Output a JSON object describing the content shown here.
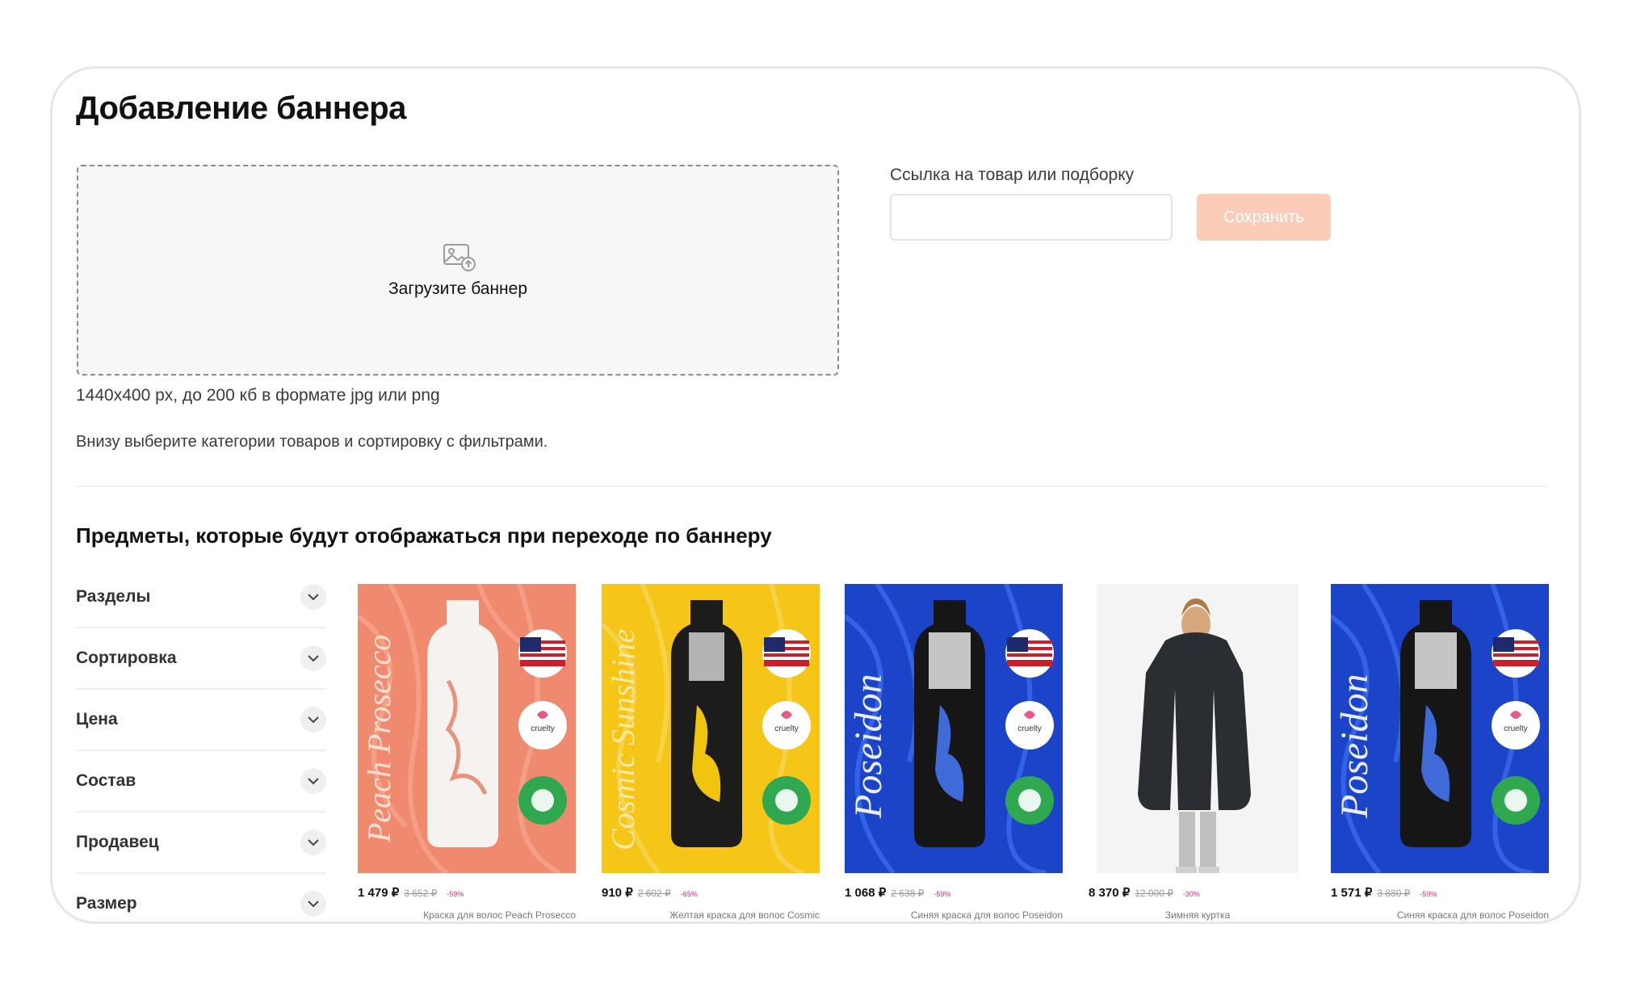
{
  "page": {
    "title": "Добавление баннера",
    "upload": {
      "label": "Загрузите баннер"
    },
    "hint_size": "1440х400 px, до 200 кб в формате jpg или png",
    "hint_categories": "Внизу выберите категории товаров и сортировку с фильтрами.",
    "link": {
      "label": "Ссылка на товар или подборку",
      "value": "",
      "placeholder": ""
    },
    "save_label": "Сохранить",
    "colors": {
      "accent_disabled": "#fbcdb8",
      "discount": "#e2257a"
    }
  },
  "section": {
    "title": "Предметы, которые будут отображаться при переходе по баннеру"
  },
  "filters": [
    {
      "label": "Разделы"
    },
    {
      "label": "Сортировка"
    },
    {
      "label": "Цена"
    },
    {
      "label": "Состав"
    },
    {
      "label": "Продавец"
    },
    {
      "label": "Размер"
    }
  ],
  "products": [
    {
      "price": "1 479 ₽",
      "old_price": "3 652 ₽",
      "discount": "-59%",
      "name": "Краска для волос Peach Prosecco",
      "bottle_text": "Peach Prosecco"
    },
    {
      "price": "910 ₽",
      "old_price": "2 602 ₽",
      "discount": "-65%",
      "name": "Желтая краска для волос Cosmic",
      "bottle_text": "Cosmic Sunshine"
    },
    {
      "price": "1 068 ₽",
      "old_price": "2 638 ₽",
      "discount": "-59%",
      "name": "Синяя краска для волос Poseidon",
      "bottle_text": "Poseidon"
    },
    {
      "price": "8 370 ₽",
      "old_price": "12 000 ₽",
      "discount": "-30%",
      "name": "Зимняя куртка",
      "bottle_text": ""
    },
    {
      "price": "1 571 ₽",
      "old_price": "3 880 ₽",
      "discount": "-59%",
      "name": "Синяя краска для волос Poseidon",
      "bottle_text": "Poseidon"
    }
  ]
}
